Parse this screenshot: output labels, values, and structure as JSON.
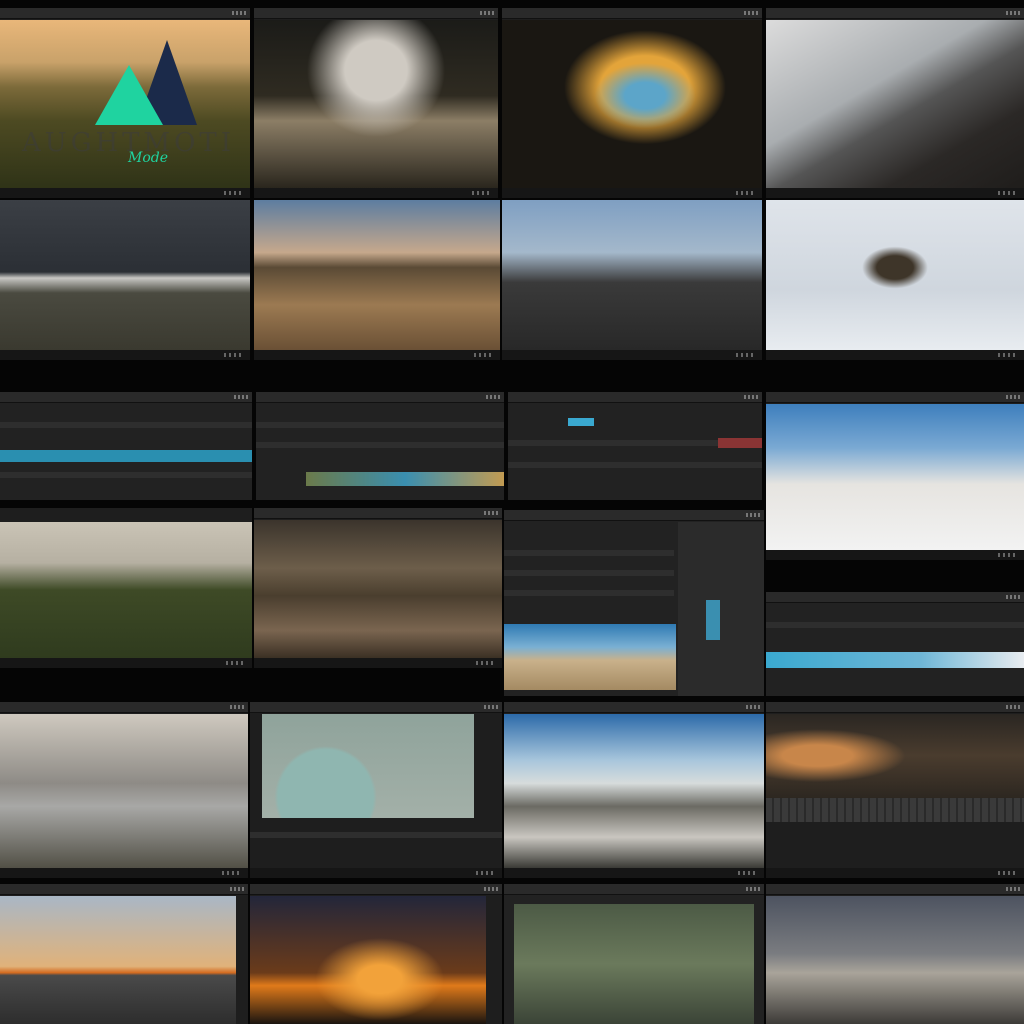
{
  "logo": {
    "text": "AUGHTMOTI",
    "sub": "Mode"
  },
  "panels": [
    {
      "header": "",
      "footer": ""
    },
    {
      "header": "",
      "footer": ""
    },
    {
      "header": "",
      "footer": ""
    },
    {
      "header": "",
      "footer": ""
    },
    {
      "header": "",
      "footer": ""
    },
    {
      "header": "",
      "footer": ""
    },
    {
      "header": "",
      "footer": ""
    },
    {
      "header": "",
      "footer": ""
    }
  ],
  "colors": {
    "accent_green": "#1fd3a0",
    "accent_navy": "#1b2a4a",
    "ui_dark": "#1e1e1e"
  }
}
